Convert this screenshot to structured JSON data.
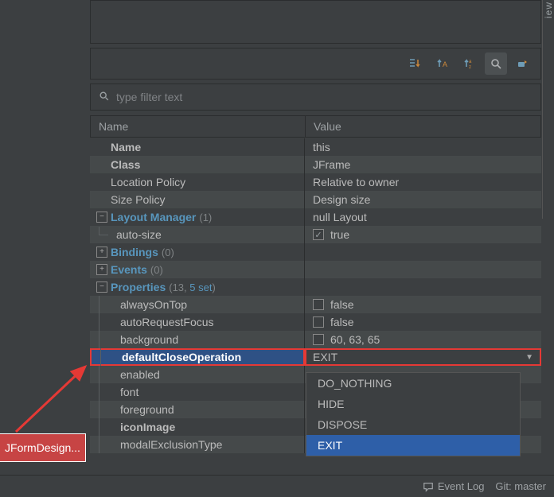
{
  "side_label": "iew",
  "filter": {
    "placeholder": "type filter text"
  },
  "columns": {
    "name": "Name",
    "value": "Value"
  },
  "rows": {
    "name": {
      "label": "Name",
      "value": "this"
    },
    "class": {
      "label": "Class",
      "value": "JFrame"
    },
    "locpolicy": {
      "label": "Location Policy",
      "value": "Relative to owner"
    },
    "sizepolicy": {
      "label": "Size Policy",
      "value": "Design size"
    },
    "layoutmgr": {
      "label": "Layout Manager",
      "count": "(1)",
      "value": "null Layout"
    },
    "autosize": {
      "label": "auto-size",
      "value": "true"
    },
    "bindings": {
      "label": "Bindings",
      "count": "(0)"
    },
    "events": {
      "label": "Events",
      "count": "(0)"
    },
    "properties": {
      "label": "Properties",
      "count1": "(13, ",
      "count2": "5 set",
      "count3": ")"
    },
    "alwaysontop": {
      "label": "alwaysOnTop",
      "value": "false"
    },
    "autoreqfocus": {
      "label": "autoRequestFocus",
      "value": "false"
    },
    "background": {
      "label": "background",
      "value": "60, 63, 65"
    },
    "defclose": {
      "label": "defaultCloseOperation",
      "value": "EXIT"
    },
    "enabled": {
      "label": "enabled"
    },
    "font": {
      "label": "font"
    },
    "foreground": {
      "label": "foreground"
    },
    "iconimage": {
      "label": "iconImage"
    },
    "modalexcl": {
      "label": "modalExclusionType"
    }
  },
  "dropdown": [
    "DO_NOTHING",
    "HIDE",
    "DISPOSE",
    "EXIT"
  ],
  "dropdown_selected": "EXIT",
  "tag": "JFormDesign...",
  "status": {
    "eventlog": "Event Log",
    "git": "Git: master"
  }
}
